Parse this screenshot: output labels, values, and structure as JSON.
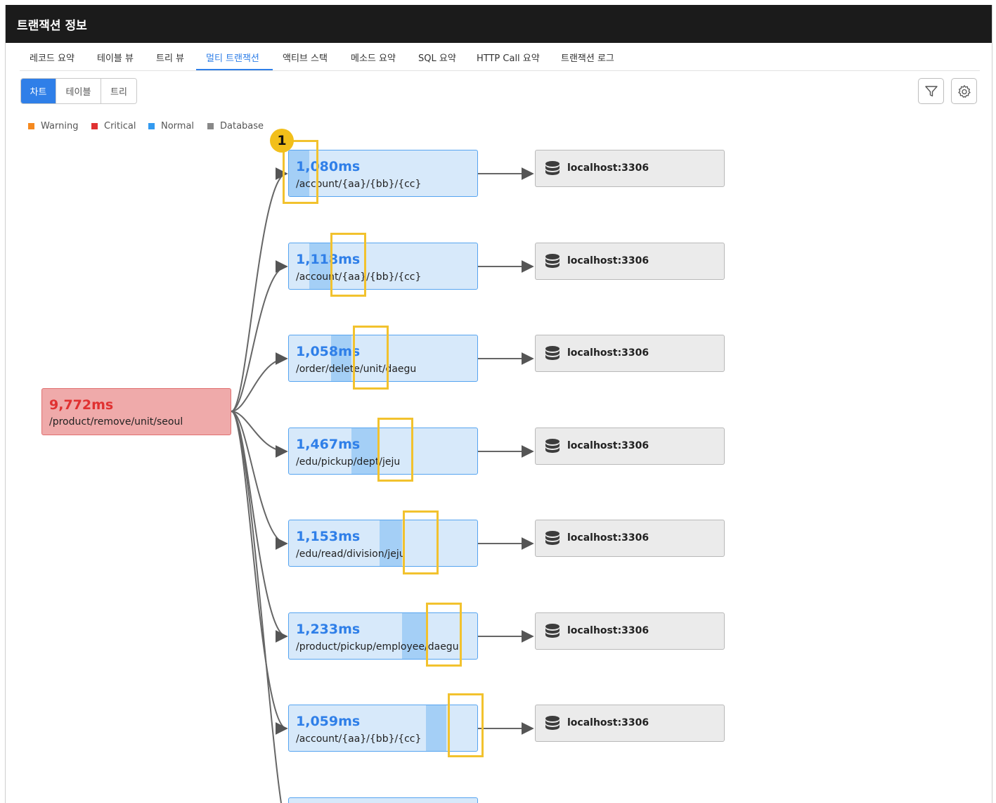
{
  "window": {
    "title": "트랜잭션 정보"
  },
  "tabs": [
    {
      "label": "레코드 요약"
    },
    {
      "label": "테이블 뷰"
    },
    {
      "label": "트리 뷰"
    },
    {
      "label": "멀티 트랜잭션"
    },
    {
      "label": "액티브 스택"
    },
    {
      "label": "메소드 요약"
    },
    {
      "label": "SQL 요약"
    },
    {
      "label": "HTTP Call 요약"
    },
    {
      "label": "트랜잭션 로그"
    }
  ],
  "active_tab": "멀티 트랜잭션",
  "view_modes": {
    "chart": "차트",
    "table": "테이블",
    "tree": "트리",
    "selected": "차트"
  },
  "toolbar": {
    "filter_icon": "filter-icon",
    "settings_icon": "gear-icon"
  },
  "legend": [
    {
      "label": "Warning",
      "color": "#f5891f"
    },
    {
      "label": "Critical",
      "color": "#e03131"
    },
    {
      "label": "Normal",
      "color": "#339af0"
    },
    {
      "label": "Database",
      "color": "#888888"
    }
  ],
  "root": {
    "duration": "9,772ms",
    "path": "/product/remove/unit/seoul",
    "status": "Critical"
  },
  "children": [
    {
      "duration": "1,080ms",
      "path": "/account/{aa}/{bb}/{cc}",
      "db": "localhost:3306",
      "bar_start": 0.0,
      "bar_width": 0.11
    },
    {
      "duration": "1,118ms",
      "path": "/account/{aa}/{bb}/{cc}",
      "db": "localhost:3306",
      "bar_start": 0.11,
      "bar_width": 0.114
    },
    {
      "duration": "1,058ms",
      "path": "/order/delete/unit/daegu",
      "db": "localhost:3306",
      "bar_start": 0.225,
      "bar_width": 0.108
    },
    {
      "duration": "1,467ms",
      "path": "/edu/pickup/dept/jeju",
      "db": "localhost:3306",
      "bar_start": 0.333,
      "bar_width": 0.15
    },
    {
      "duration": "1,153ms",
      "path": "/edu/read/division/jeju",
      "db": "localhost:3306",
      "bar_start": 0.483,
      "bar_width": 0.118
    },
    {
      "duration": "1,233ms",
      "path": "/product/pickup/employee/daegu",
      "db": "localhost:3306",
      "bar_start": 0.601,
      "bar_width": 0.126
    },
    {
      "duration": "1,059ms",
      "path": "/account/{aa}/{bb}/{cc}",
      "db": "localhost:3306",
      "bar_start": 0.727,
      "bar_width": 0.108
    }
  ],
  "callout": {
    "number": "1"
  }
}
